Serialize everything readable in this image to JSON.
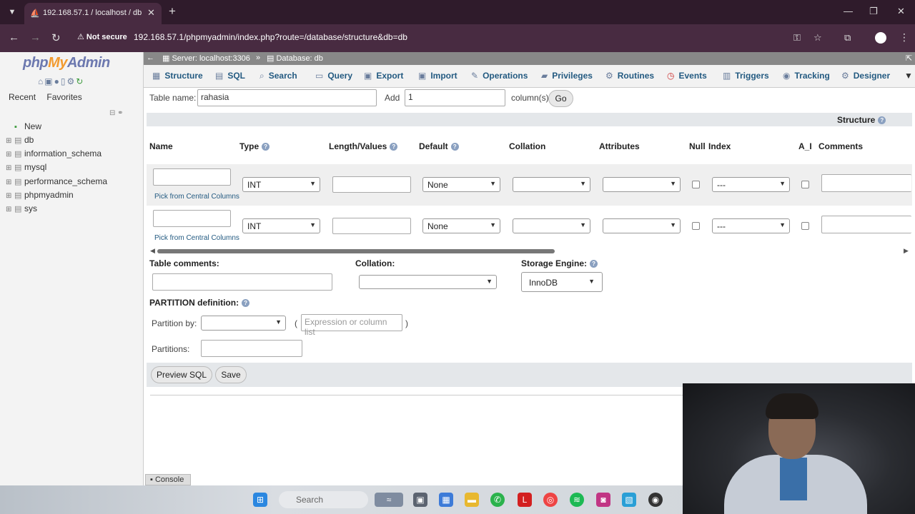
{
  "browser": {
    "tab_title": "192.168.57.1 / localhost / db / ...",
    "tab_menu_icon": "chevron-down-icon",
    "close_tab_glyph": "✕",
    "new_tab_glyph": "+",
    "minimize_glyph": "—",
    "maximize_glyph": "❐",
    "close_window_glyph": "✕",
    "back_glyph": "←",
    "forward_glyph": "→",
    "reload_glyph": "↻",
    "security_label": "Not secure",
    "url": "192.168.57.1/phpmyadmin/index.php?route=/database/structure&db=db"
  },
  "left_panel": {
    "logo_php": "php",
    "logo_my": "My",
    "logo_admin": "Admin",
    "tabs": [
      "Recent",
      "Favorites"
    ],
    "tree": [
      {
        "label": "New"
      },
      {
        "label": "db"
      },
      {
        "label": "information_schema"
      },
      {
        "label": "mysql"
      },
      {
        "label": "performance_schema"
      },
      {
        "label": "phpmyadmin"
      },
      {
        "label": "sys"
      }
    ]
  },
  "breadcrumb": {
    "server": "Server: localhost:3306",
    "sep": "»",
    "database": "Database: db"
  },
  "menu": [
    {
      "label": "Structure",
      "icon": "structure-icon"
    },
    {
      "label": "SQL",
      "icon": "sql-icon"
    },
    {
      "label": "Search",
      "icon": "search-icon"
    },
    {
      "label": "Query",
      "icon": "query-icon"
    },
    {
      "label": "Export",
      "icon": "export-icon"
    },
    {
      "label": "Import",
      "icon": "import-icon"
    },
    {
      "label": "Operations",
      "icon": "wrench-icon"
    },
    {
      "label": "Privileges",
      "icon": "privileges-icon"
    },
    {
      "label": "Routines",
      "icon": "routines-icon"
    },
    {
      "label": "Events",
      "icon": "clock-icon"
    },
    {
      "label": "Triggers",
      "icon": "triggers-icon"
    },
    {
      "label": "Tracking",
      "icon": "eye-icon"
    },
    {
      "label": "Designer",
      "icon": "designer-icon"
    }
  ],
  "create_table": {
    "table_name_label": "Table name:",
    "table_name_value": "rahasia",
    "add_label": "Add",
    "add_value": "1",
    "columns_label": "column(s)",
    "go_label": "Go",
    "structure_label": "Structure",
    "headers": {
      "name": "Name",
      "type": "Type",
      "length": "Length/Values",
      "default": "Default",
      "collation": "Collation",
      "attributes": "Attributes",
      "null": "Null",
      "index": "Index",
      "ai": "A_I",
      "comments": "Comments"
    },
    "rows": [
      {
        "type": "INT",
        "default": "None",
        "index": "---",
        "pick_label": "Pick from Central Columns"
      },
      {
        "type": "INT",
        "default": "None",
        "index": "---",
        "pick_label": "Pick from Central Columns"
      }
    ]
  },
  "table_options": {
    "table_comments_label": "Table comments:",
    "collation_label": "Collation:",
    "storage_engine_label": "Storage Engine:",
    "storage_engine_value": "InnoDB",
    "partition_title": "PARTITION definition:",
    "partition_by_label": "Partition by:",
    "expression_placeholder": "Expression or column list",
    "partitions_label": "Partitions:",
    "paren_open": "(",
    "paren_close": ")"
  },
  "actions": {
    "preview_sql": "Preview SQL",
    "save": "Save"
  },
  "console_label": "Console",
  "taskbar": {
    "search_placeholder": "Search"
  }
}
